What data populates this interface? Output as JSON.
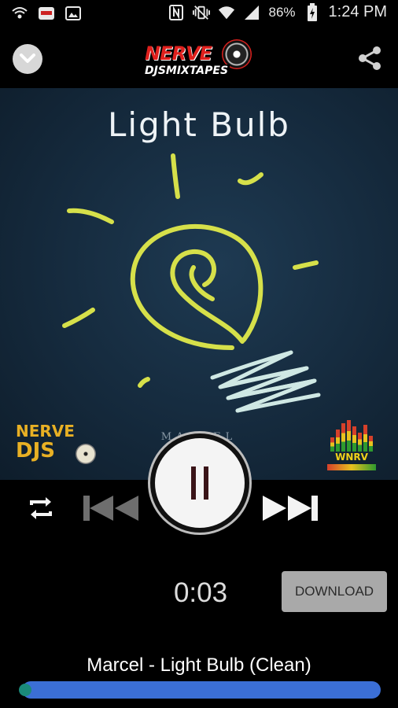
{
  "status_bar": {
    "battery_percent": "86%",
    "time": "1:24 PM",
    "left_icons": [
      "wifi-call-icon",
      "app-icon",
      "image-icon"
    ],
    "right_icons": [
      "nfc-icon",
      "vibrate-icon",
      "wifi-icon",
      "signal-icon",
      "battery-icon"
    ]
  },
  "header": {
    "logo_top": "NERVE",
    "logo_bottom": "DJSMIXTAPES",
    "collapse_icon": "chevron-down-icon",
    "share_icon": "share-icon"
  },
  "album_art": {
    "title": "Light Bulb",
    "artist_watermark": "MARCEL",
    "nerve_logo_line1": "NERVE",
    "nerve_logo_line2": "DJS",
    "wnrv_logo": "WNRV"
  },
  "player": {
    "state": "playing",
    "play_pause_icon": "pause-icon",
    "repeat_icon": "repeat-icon",
    "prev_icon": "skip-previous-icon",
    "next_icon": "skip-next-icon",
    "elapsed": "0:03",
    "download_label": "DOWNLOAD",
    "track_title": "Marcel - Light Bulb (Clean)",
    "progress_fraction": 0.01
  },
  "colors": {
    "accent_blue": "#3b6fd6",
    "thumb_teal": "#1a8a7a",
    "background": "#000000",
    "download_button": "#a9a9a9"
  }
}
